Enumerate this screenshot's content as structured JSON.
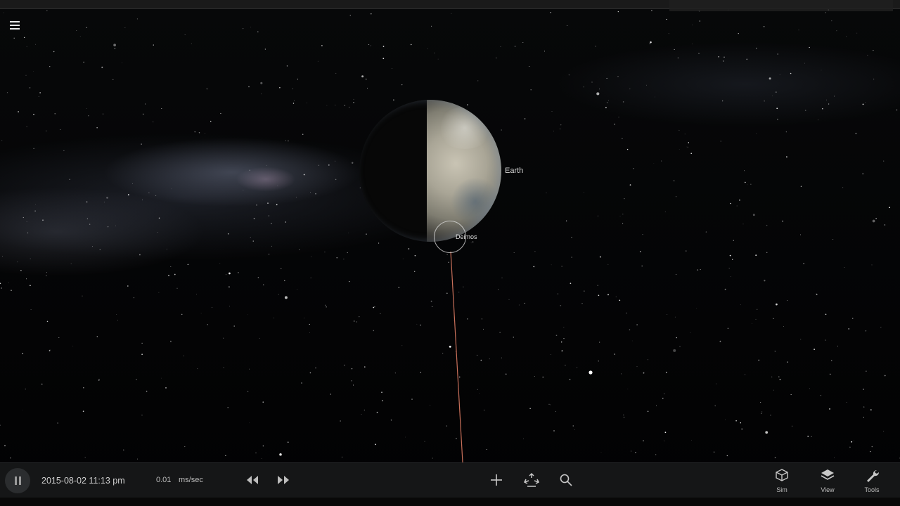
{
  "app": {
    "menu_icon": "hamburger-menu-icon"
  },
  "scene": {
    "planet_label": "Earth",
    "moon_label": "Deimos",
    "orbit_color": "#c8705a"
  },
  "toolbar": {
    "play_pause_icon": "pause-icon",
    "datetime": "2015-08-02 11:13 pm",
    "rate_value": "0.01",
    "rate_unit": "ms/sec",
    "rewind_icon": "rewind-icon",
    "fastforward_icon": "fast-forward-icon",
    "add_icon": "plus-icon",
    "move_icon": "move-arrows-icon",
    "search_icon": "search-icon",
    "sim_label": "Sim",
    "view_label": "View",
    "tools_label": "Tools"
  },
  "colors": {
    "toolbar_bg": "#151617",
    "text": "#cfcfcf"
  }
}
